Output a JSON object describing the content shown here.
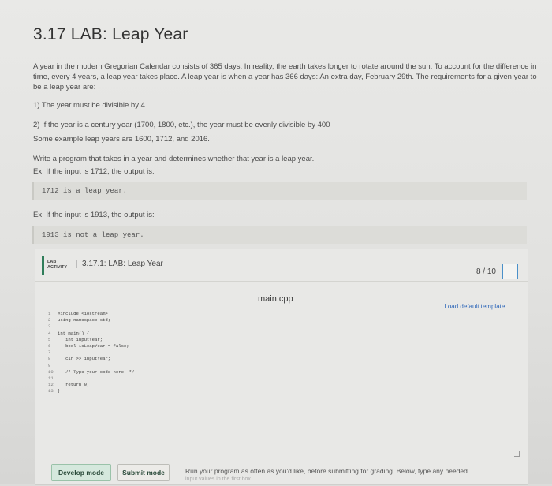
{
  "title": "3.17 LAB: Leap Year",
  "description": {
    "intro": "A year in the modern Gregorian Calendar consists of 365 days. In reality, the earth takes longer to rotate around the sun. To account for the difference in time, every 4 years, a leap year takes place. A leap year is when a year has 366 days: An extra day, February 29th. The requirements for a given year to be a leap year are:",
    "req1": "1) The year must be divisible by 4",
    "req2": "2) If the year is a century year (1700, 1800, etc.), the year must be evenly divisible by 400",
    "examples": "Some example leap years are 1600, 1712, and 2016.",
    "task": "Write a program that takes in a year and determines whether that year is a leap year.",
    "ex1_label": "Ex: If the input is 1712, the output is:",
    "ex1_output": "1712 is a leap year.",
    "ex2_label": "Ex: If the input is 1913, the output is:",
    "ex2_output": "1913 is not a leap year."
  },
  "lab": {
    "badge": "LAB ACTIVITY",
    "name": "3.17.1: LAB: Leap Year",
    "score": "8 / 10",
    "file_name": "main.cpp",
    "load_template": "Load default template...",
    "code": [
      {
        "n": "1",
        "text": "#include <iostream>"
      },
      {
        "n": "2",
        "text": "using namespace std;"
      },
      {
        "n": "3",
        "text": ""
      },
      {
        "n": "4",
        "text": "int main() {"
      },
      {
        "n": "5",
        "text": "   int inputYear;"
      },
      {
        "n": "6",
        "text": "   bool isLeapYear = false;"
      },
      {
        "n": "7",
        "text": ""
      },
      {
        "n": "8",
        "text": "   cin >> inputYear;"
      },
      {
        "n": "9",
        "text": ""
      },
      {
        "n": "10",
        "text": "   /* Type your code here. */"
      },
      {
        "n": "11",
        "text": ""
      },
      {
        "n": "12",
        "text": "   return 0;"
      },
      {
        "n": "13",
        "text": "}"
      }
    ],
    "develop_mode": "Develop mode",
    "submit_mode": "Submit mode",
    "run_note": "Run your program as often as you'd like, before submitting for grading. Below, type any needed",
    "run_note2": "input values in the first box"
  },
  "colors": {
    "accent_green": "#2f7d5a",
    "link_blue": "#2d66b8"
  }
}
